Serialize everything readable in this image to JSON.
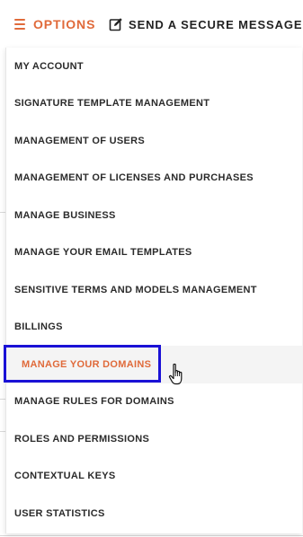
{
  "topbar": {
    "options_label": "OPTIONS",
    "send_label": "SEND A SECURE MESSAGE"
  },
  "menu": {
    "items": [
      {
        "label": "MY ACCOUNT",
        "active": false
      },
      {
        "label": "SIGNATURE TEMPLATE MANAGEMENT",
        "active": false
      },
      {
        "label": "MANAGEMENT OF USERS",
        "active": false
      },
      {
        "label": "MANAGEMENT OF LICENSES AND PURCHASES",
        "active": false
      },
      {
        "label": "MANAGE BUSINESS",
        "active": false
      },
      {
        "label": "MANAGE YOUR EMAIL TEMPLATES",
        "active": false
      },
      {
        "label": "SENSITIVE TERMS AND MODELS MANAGEMENT",
        "active": false
      },
      {
        "label": "BILLINGS",
        "active": false
      },
      {
        "label": "MANAGE YOUR DOMAINS",
        "active": true
      },
      {
        "label": "MANAGE RULES FOR DOMAINS",
        "active": false
      },
      {
        "label": "ROLES AND PERMISSIONS",
        "active": false
      },
      {
        "label": "CONTEXTUAL KEYS",
        "active": false
      },
      {
        "label": "USER STATISTICS",
        "active": false
      }
    ]
  },
  "colors": {
    "accent": "#e06a3a",
    "highlight_border": "#1a11d6",
    "text": "#2b2b2b",
    "active_bg": "#f4f4f4"
  },
  "icons": {
    "options": "hamburger-menu-icon",
    "send": "edit-message-icon",
    "cursor": "hand-pointer-cursor"
  }
}
